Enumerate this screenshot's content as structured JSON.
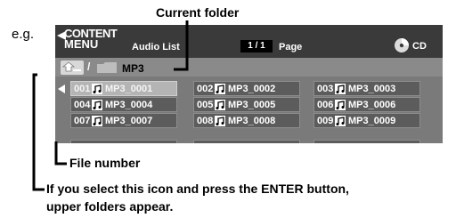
{
  "annotations": {
    "current_folder": "Current folder",
    "eg": "e.g.",
    "file_number": "File number",
    "upper_folder_note_line1": "If you select this icon and press the ENTER button,",
    "upper_folder_note_line2": "upper folders appear."
  },
  "screen": {
    "header": {
      "content": "CONTENT",
      "menu": "MENU",
      "audio_list": "Audio List",
      "page_indicator": "1 / 1",
      "page_label": "Page",
      "disc_label": "CD"
    },
    "path": {
      "separator": "/",
      "folder_name": "MP3"
    },
    "files": [
      {
        "number": "001",
        "name": "MP3_0001",
        "selected": true
      },
      {
        "number": "002",
        "name": "MP3_0002",
        "selected": false
      },
      {
        "number": "003",
        "name": "MP3_0003",
        "selected": false
      },
      {
        "number": "004",
        "name": "MP3_0004",
        "selected": false
      },
      {
        "number": "005",
        "name": "MP3_0005",
        "selected": false
      },
      {
        "number": "006",
        "name": "MP3_0006",
        "selected": false
      },
      {
        "number": "007",
        "name": "MP3_0007",
        "selected": false
      },
      {
        "number": "008",
        "name": "MP3_0008",
        "selected": false
      },
      {
        "number": "009",
        "name": "MP3_0009",
        "selected": false
      }
    ],
    "icons": {
      "up_folder": "up-folder-icon",
      "folder": "folder-icon",
      "music": "music-note-icon",
      "disc": "cd-icon",
      "back": "back-arrow-icon",
      "left": "left-arrow-icon"
    }
  }
}
